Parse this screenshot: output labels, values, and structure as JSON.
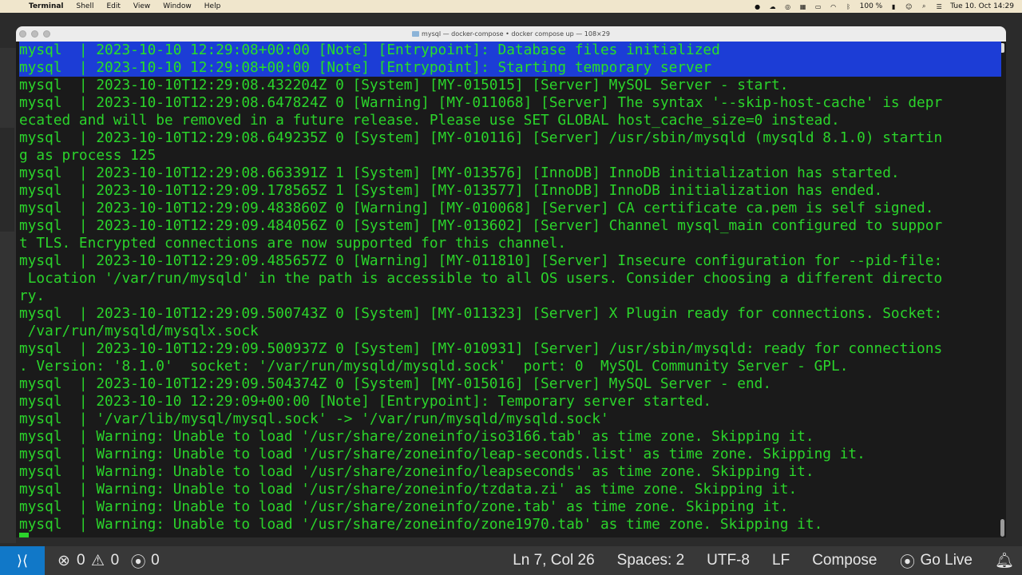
{
  "menubar": {
    "app": "Terminal",
    "menus": [
      "Shell",
      "Edit",
      "View",
      "Window",
      "Help"
    ],
    "battery": "100 %",
    "datetime": "Tue 10. Oct 14:29"
  },
  "window": {
    "title": "mysql — docker-compose • docker compose up — 108×29"
  },
  "terminal": {
    "lines": [
      "mysql  | 2023-10-10 12:29:08+00:00 [Note] [Entrypoint]: Database files initialized",
      "mysql  | 2023-10-10 12:29:08+00:00 [Note] [Entrypoint]: Starting temporary server",
      "mysql  | 2023-10-10T12:29:08.432204Z 0 [System] [MY-015015] [Server] MySQL Server - start.",
      "mysql  | 2023-10-10T12:29:08.647824Z 0 [Warning] [MY-011068] [Server] The syntax '--skip-host-cache' is depr",
      "ecated and will be removed in a future release. Please use SET GLOBAL host_cache_size=0 instead.",
      "mysql  | 2023-10-10T12:29:08.649235Z 0 [System] [MY-010116] [Server] /usr/sbin/mysqld (mysqld 8.1.0) startin",
      "g as process 125",
      "mysql  | 2023-10-10T12:29:08.663391Z 1 [System] [MY-013576] [InnoDB] InnoDB initialization has started.",
      "mysql  | 2023-10-10T12:29:09.178565Z 1 [System] [MY-013577] [InnoDB] InnoDB initialization has ended.",
      "mysql  | 2023-10-10T12:29:09.483860Z 0 [Warning] [MY-010068] [Server] CA certificate ca.pem is self signed.",
      "mysql  | 2023-10-10T12:29:09.484056Z 0 [System] [MY-013602] [Server] Channel mysql_main configured to suppor",
      "t TLS. Encrypted connections are now supported for this channel.",
      "mysql  | 2023-10-10T12:29:09.485657Z 0 [Warning] [MY-011810] [Server] Insecure configuration for --pid-file:",
      " Location '/var/run/mysqld' in the path is accessible to all OS users. Consider choosing a different directo",
      "ry.",
      "mysql  | 2023-10-10T12:29:09.500743Z 0 [System] [MY-011323] [Server] X Plugin ready for connections. Socket:",
      " /var/run/mysqld/mysqlx.sock",
      "mysql  | 2023-10-10T12:29:09.500937Z 0 [System] [MY-010931] [Server] /usr/sbin/mysqld: ready for connections",
      ". Version: '8.1.0'  socket: '/var/run/mysqld/mysqld.sock'  port: 0  MySQL Community Server - GPL.",
      "mysql  | 2023-10-10T12:29:09.504374Z 0 [System] [MY-015016] [Server] MySQL Server - end.",
      "mysql  | 2023-10-10 12:29:09+00:00 [Note] [Entrypoint]: Temporary server started.",
      "mysql  | '/var/lib/mysql/mysql.sock' -> '/var/run/mysqld/mysqld.sock'",
      "mysql  | Warning: Unable to load '/usr/share/zoneinfo/iso3166.tab' as time zone. Skipping it.",
      "mysql  | Warning: Unable to load '/usr/share/zoneinfo/leap-seconds.list' as time zone. Skipping it.",
      "mysql  | Warning: Unable to load '/usr/share/zoneinfo/leapseconds' as time zone. Skipping it.",
      "mysql  | Warning: Unable to load '/usr/share/zoneinfo/tzdata.zi' as time zone. Skipping it.",
      "mysql  | Warning: Unable to load '/usr/share/zoneinfo/zone.tab' as time zone. Skipping it.",
      "mysql  | Warning: Unable to load '/usr/share/zoneinfo/zone1970.tab' as time zone. Skipping it."
    ],
    "selected_line_count": 2,
    "text_color": "#2bd42b",
    "selection_color": "#1c3dd6"
  },
  "statusbar": {
    "errors": "0",
    "warnings": "0",
    "ports": "0",
    "cursor_position": "Ln 7, Col 26",
    "spaces": "Spaces: 2",
    "encoding": "UTF-8",
    "eol": "LF",
    "language": "Compose",
    "go_live": "Go Live",
    "accent": "#1178c8"
  }
}
